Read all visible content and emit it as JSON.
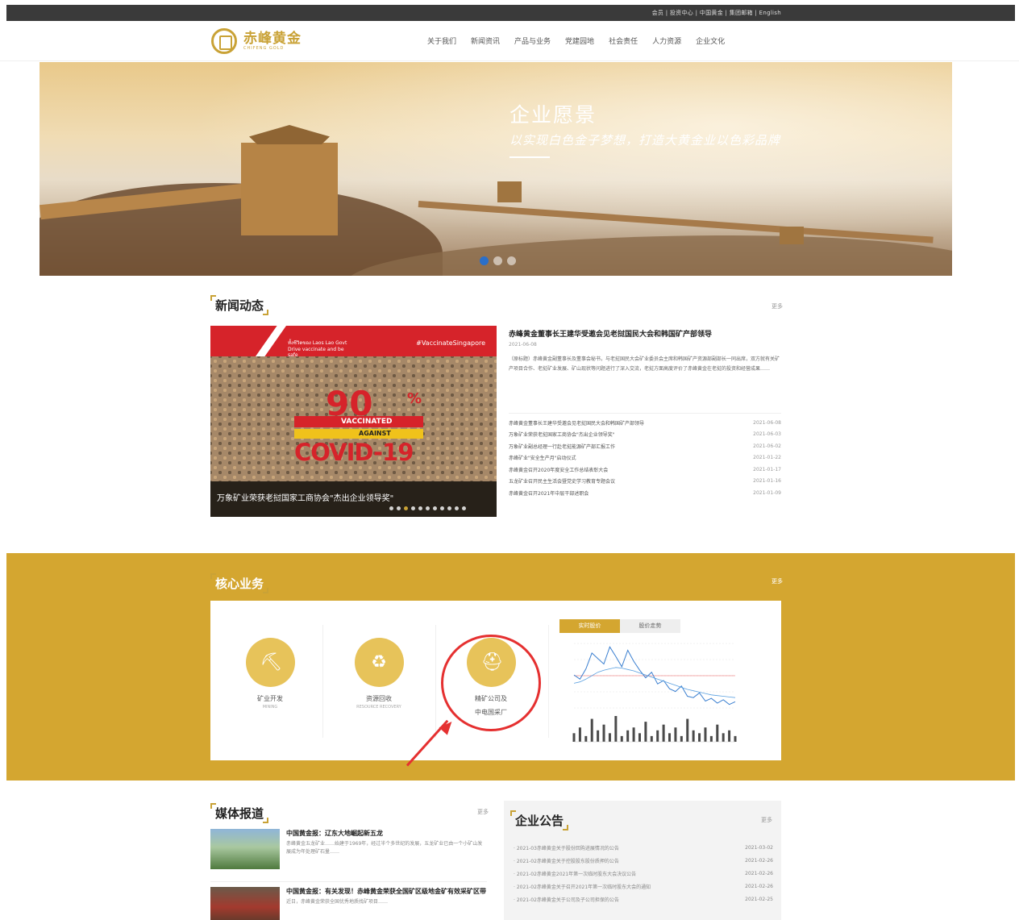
{
  "topbar": {
    "links": "会员 | 投资中心 | 中国黄金 | 集团邮箱 | English"
  },
  "logo": {
    "name": "赤峰黄金",
    "en": "CHIFENG GOLD"
  },
  "nav": [
    "关于我们",
    "新闻资讯",
    "产品与业务",
    "党建园地",
    "社会责任",
    "人力资源",
    "企业文化"
  ],
  "banner": {
    "title": "企业愿景",
    "subtitle": "以实现白色金子梦想，打造大黄金业以色彩品牌",
    "slides": 3,
    "active_slide": 1
  },
  "news": {
    "title": "新闻动态",
    "more": "更多",
    "slider": {
      "band_text": "ทั้งชีวิตของ Laos Lao Govt Drive vaccinate and be safe",
      "tag": "#VaccinateSingapore",
      "big": "90",
      "pct": "%",
      "vaccinated": "VACCINATED",
      "against": "AGAINST",
      "covid": "COVID-19",
      "caption": "万象矿业荣获老挝国家工商协会\"杰出企业领导奖\"",
      "dot_count": 11,
      "active_dot": 2
    },
    "headline": "赤峰黄金董事长王建华受邀会见老挝国民大会和韩国矿产部领导",
    "headline_date": "2021-06-08",
    "excerpt": "（原标题）赤峰黄金副董事长及董事会秘书，与老挝国民大会矿业委员会主席和韩国矿产资源部副部长一同出席，双方就有关矿产项目合作、老挝矿业发展、矿山现状等问题进行了深入交流，老挝方面高度评价了赤峰黄金在老挝的投资和经营成果……",
    "items": [
      {
        "title": "赤峰黄金董事长王建华受邀会见老挝国民大会和韩国矿产部领导",
        "date": "2021-06-08"
      },
      {
        "title": "万象矿业荣获老挝国家工商协会\"杰出企业领导奖\"",
        "date": "2021-06-03"
      },
      {
        "title": "万象矿业副总经理一行赴老挝能源矿产部汇报工作",
        "date": "2021-06-02"
      },
      {
        "title": "赤峰矿业\"安全生产月\"启动仪式",
        "date": "2021-01-22"
      },
      {
        "title": "赤峰黄金召开2020年度安全工作总结表彰大会",
        "date": "2021-01-17"
      },
      {
        "title": "五龙矿业召开民主生活会暨党史学习教育专题会议",
        "date": "2021-01-16"
      },
      {
        "title": "赤峰黄金召开2021年中层干部述职会",
        "date": "2021-01-09"
      }
    ]
  },
  "core": {
    "title": "核心业务",
    "more": "更多",
    "services": [
      {
        "label": "矿业开发",
        "sub": "MINING"
      },
      {
        "label": "资源回收",
        "sub": "RESOURCE RECOVERY"
      },
      {
        "label": "精矿公司及",
        "label2": "中电国采厂"
      }
    ],
    "chart_tabs": [
      "实时股价",
      "股价走势"
    ]
  },
  "chart_data": {
    "type": "line",
    "title": "",
    "series": [
      {
        "values": [
          18.2,
          17.6,
          19.1,
          21.4,
          20.6,
          19.8,
          22.3,
          20.9,
          19.4,
          21.8,
          20.2,
          18.9,
          17.8,
          18.6,
          16.9,
          17.4,
          16.2,
          15.8,
          16.6,
          15.1,
          14.9,
          15.6,
          14.4,
          14.8,
          14.1,
          14.6,
          13.9,
          14.3
        ]
      },
      {
        "values": [
          17.0,
          17.2,
          17.6,
          18.1,
          18.6,
          18.9,
          19.1,
          19.3,
          19.2,
          19.0,
          18.8,
          18.5,
          18.2,
          17.9,
          17.6,
          17.3,
          17.0,
          16.7,
          16.4,
          16.1,
          15.9,
          15.7,
          15.5,
          15.3,
          15.2,
          15.1,
          15.0,
          14.9
        ]
      }
    ],
    "volume": [
      3,
      5,
      2,
      8,
      4,
      6,
      3,
      9,
      2,
      4,
      5,
      3,
      7,
      2,
      4,
      6,
      3,
      5,
      2,
      8,
      4,
      3,
      5,
      2,
      6,
      3,
      4,
      2
    ],
    "colors": {
      "price": "#3a7fd0",
      "avg": "#5aa0e0",
      "volume": "#4a4a4a",
      "upper": "#e53030"
    }
  },
  "media": {
    "title": "媒体报道",
    "more": "更多",
    "items": [
      {
        "title": "中国黄金报：辽东大地崛起新五龙",
        "excerpt": "赤峰黄金五龙矿业……始建于1969年，经过半个多世纪的发展，五龙矿业已由一个小矿山发展成为年处理矿石量……"
      },
      {
        "title": "中国黄金报：有关发现！赤峰黄金荣获全国矿区级地金矿有效采矿区带",
        "excerpt": "近日，赤峰黄金荣获全国优秀地质找矿项目……"
      }
    ]
  },
  "notice": {
    "title": "企业公告",
    "more": "更多",
    "items": [
      {
        "title": "· 2021-03赤峰黄金关于股份回购进展情况的公告",
        "date": "2021-03-02"
      },
      {
        "title": "· 2021-02赤峰黄金关于控股股东股份质押的公告",
        "date": "2021-02-26"
      },
      {
        "title": "· 2021-02赤峰黄金2021年第一次临时股东大会决议公告",
        "date": "2021-02-26"
      },
      {
        "title": "· 2021-02赤峰黄金关于召开2021年第一次临时股东大会的通知",
        "date": "2021-02-26"
      },
      {
        "title": "· 2021-02赤峰黄金关于公司及子公司担保的公告",
        "date": "2021-02-25"
      }
    ]
  }
}
